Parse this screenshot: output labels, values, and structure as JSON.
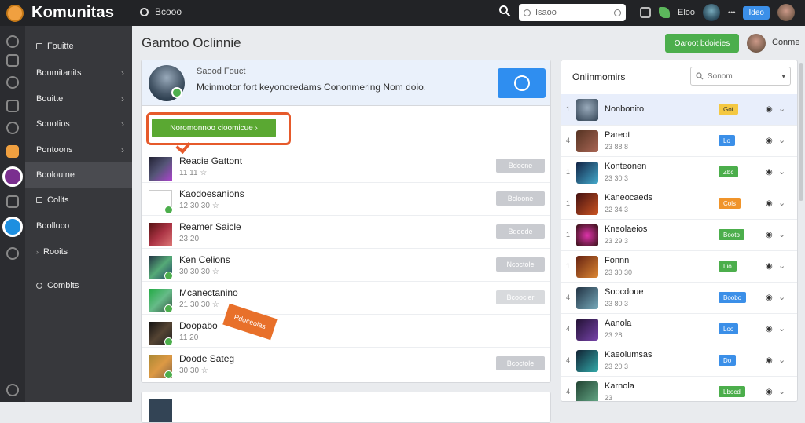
{
  "app": {
    "name": "Komunitas"
  },
  "topbar": {
    "left_label": "Bcooo",
    "search_value": "Isaoo",
    "right_label": "Eloo",
    "action_label": "Ideo"
  },
  "sidebar": {
    "items": [
      {
        "label": "Fouitte"
      },
      {
        "label": "Boumitanits"
      },
      {
        "label": "Bouitte"
      },
      {
        "label": "Souotios"
      },
      {
        "label": "Pontoons"
      },
      {
        "label": "Boolouine"
      },
      {
        "label": "Collts"
      },
      {
        "label": "Boolluco"
      },
      {
        "label": "Rooits"
      },
      {
        "label": "Combits"
      }
    ]
  },
  "main": {
    "title": "Gamtoo Oclinnie",
    "primary_button": "Oaroot bdoieies",
    "user_name": "Conme"
  },
  "composer": {
    "name": "Saood Fouct",
    "text": "Mcinmotor fort keyonoredams Cononmering Nom doio."
  },
  "join_button": "Noromonnoo cioomicue ›",
  "games": [
    {
      "title": "Reacie Gattont",
      "meta": "11 11 ☆",
      "btn": "Bdocne"
    },
    {
      "title": "Kaodoesanions",
      "meta": "12 30 30 ☆",
      "btn": "Bcloone"
    },
    {
      "title": "Reamer Saicle",
      "meta": "23 20",
      "btn": "Bdoode"
    },
    {
      "title": "Ken Celions",
      "meta": "30 30 30 ☆",
      "btn": "Ncoctole"
    },
    {
      "title": "Mcanectanino",
      "meta": "21 30 30 ☆",
      "btn": "Bcoocler"
    },
    {
      "title": "Doopabo",
      "meta": "11 20",
      "btn": "",
      "tag": "Pdoceolas"
    },
    {
      "title": "Doode Sateg",
      "meta": "30 30 ☆",
      "btn": "Bcoctole"
    }
  ],
  "online": {
    "title": "Onlinmomirs",
    "search_placeholder": "Sonom",
    "members": [
      {
        "num": "1",
        "name": "Nonbonito",
        "meta": "",
        "act": "Got",
        "act_color": "#f4c842"
      },
      {
        "num": "4",
        "name": "Pareot",
        "meta": "23 88 8",
        "act": "Lo",
        "act_color": "#3b8fe8"
      },
      {
        "num": "1",
        "name": "Konteonen",
        "meta": "23 30 3",
        "act": "Zbc",
        "act_color": "#4cae4c"
      },
      {
        "num": "1",
        "name": "Kaneocaeds",
        "meta": "22 34 3",
        "act": "Cols",
        "act_color": "#f0942a"
      },
      {
        "num": "1",
        "name": "Kneolaeios",
        "meta": "23 29 3",
        "act": "Booto",
        "act_color": "#4cae4c"
      },
      {
        "num": "1",
        "name": "Fonnn",
        "meta": "23 30 30",
        "act": "Lio",
        "act_color": "#4cae4c"
      },
      {
        "num": "4",
        "name": "Soocdoue",
        "meta": "23 80 3",
        "act": "Boobo",
        "act_color": "#3b8fe8"
      },
      {
        "num": "4",
        "name": "Aanola",
        "meta": "23 28",
        "act": "Loo",
        "act_color": "#3b8fe8"
      },
      {
        "num": "4",
        "name": "Kaeolumsas",
        "meta": "23 20 3",
        "act": "Do",
        "act_color": "#3b8fe8"
      },
      {
        "num": "4",
        "name": "Karnola",
        "meta": "23",
        "act": "Lbocd",
        "act_color": "#4cae4c"
      }
    ]
  }
}
